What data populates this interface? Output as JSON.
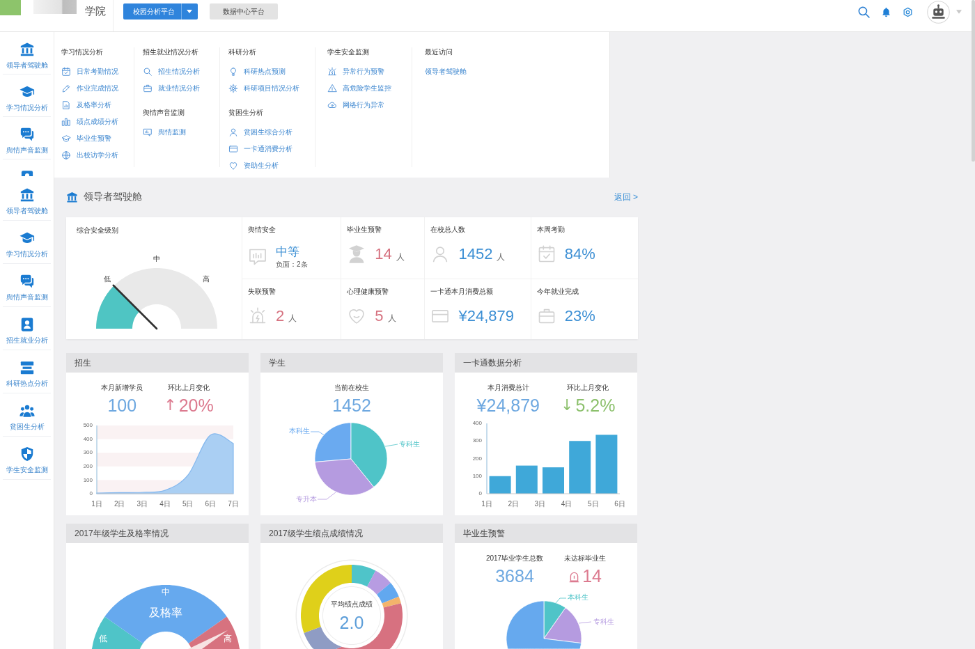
{
  "top_bar": {
    "school_name": "学院",
    "platform_buttons": [
      {
        "label": "校园分析平台",
        "selected": true,
        "dropdown": true
      },
      {
        "label": "数据中心平台",
        "selected": false,
        "dropdown": false
      }
    ]
  },
  "menu_overlay": {
    "sidebar_items": [
      "领导者驾驶舱",
      "学习情况分析",
      "舆情声音监测"
    ],
    "columns": [
      {
        "sections": [
          {
            "title": "学习情况分析",
            "items": [
              "日常考勤情况",
              "作业完成情况",
              "及格率分析",
              "绩点成绩分析",
              "毕业生预警",
              "出校访学分析"
            ]
          }
        ]
      },
      {
        "sections": [
          {
            "title": "招生就业情况分析",
            "items": [
              "招生情况分析",
              "就业情况分析"
            ]
          },
          {
            "title": "舆情声音监测",
            "items": [
              "舆情监测"
            ]
          }
        ]
      },
      {
        "sections": [
          {
            "title": "科研分析",
            "items": [
              "科研热点预测",
              "科研项目情况分析"
            ]
          },
          {
            "title": "贫困生分析",
            "items": [
              "贫困生综合分析",
              "一卡通消费分析",
              "资助生分析"
            ]
          }
        ]
      },
      {
        "sections": [
          {
            "title": "学生安全监测",
            "items": [
              "异常行为预警",
              "高危险学生监控",
              "网络行为异常"
            ]
          }
        ]
      },
      {
        "sections": [
          {
            "title": "最近访问",
            "items": [
              "领导者驾驶舱"
            ]
          }
        ]
      }
    ]
  },
  "sidebar": {
    "items": [
      "领导者驾驶舱",
      "学习情况分析",
      "舆情声音监测",
      "招生就业分析",
      "科研热点分析",
      "贫困生分析",
      "学生安全监测"
    ]
  },
  "page_header": {
    "title": "领导者驾驶舱",
    "back_link": "返回 >"
  },
  "kpi_panel": {
    "gauge": {
      "title": "综合安全级别",
      "labels": [
        "低",
        "中",
        "高"
      ],
      "level": 0.25
    },
    "metrics": [
      {
        "label": "舆情安全",
        "value": "中等",
        "note": "负面：2条",
        "color": "#3c8fd4"
      },
      {
        "label": "毕业生预警",
        "value": "14",
        "unit": "人",
        "color": "#d6717f"
      },
      {
        "label": "在校总人数",
        "value": "1452",
        "unit": "人",
        "color": "#3c8fd4"
      },
      {
        "label": "本周考勤",
        "value": "84%",
        "color": "#3c8fd4"
      },
      {
        "label": "失联预警",
        "value": "2",
        "unit": "人",
        "color": "#d6717f"
      },
      {
        "label": "心理健康预警",
        "value": "5",
        "unit": "人",
        "color": "#d6717f"
      },
      {
        "label": "一卡通本月消费总额",
        "value": "¥24,879",
        "color": "#3c8fd4"
      },
      {
        "label": "今年就业完成",
        "value": "23%",
        "color": "#3c8fd4"
      }
    ]
  },
  "panels": [
    {
      "kind": "chart",
      "title": "招生",
      "stats": [
        {
          "label": "本月新增学员",
          "value": "100",
          "color": "#6ea8e0"
        },
        {
          "label": "环比上月变化",
          "arrow": "↑",
          "value": "20%",
          "color": "#dc7a8f"
        }
      ],
      "chart_data": {
        "type": "area",
        "categories": [
          "1日",
          "2日",
          "3日",
          "4日",
          "5日",
          "6日",
          "7日"
        ],
        "values": [
          5,
          8,
          10,
          25,
          135,
          430,
          368
        ],
        "ylim": [
          0,
          500
        ],
        "yticks": [
          0,
          100,
          200,
          300,
          400,
          500
        ]
      }
    },
    {
      "kind": "pie",
      "title": "学生",
      "stats": [
        {
          "label": "当前在校生",
          "value": "1452",
          "color": "#6ea8e0"
        }
      ],
      "segments": [
        {
          "label": "本科生",
          "color": "#6aaaf0"
        },
        {
          "label": "专科生",
          "color": "#4fc4c8"
        },
        {
          "label": "专升本",
          "color": "#b59be0"
        }
      ]
    },
    {
      "kind": "chart",
      "title": "一卡通数据分析",
      "stats": [
        {
          "label": "本月消费总计",
          "value": "¥24,879",
          "color": "#6ea8e0"
        },
        {
          "label": "环比上月变化",
          "arrow": "↓",
          "value": "5.2%",
          "color": "#8cc06c"
        }
      ],
      "chart_data": {
        "type": "bar",
        "x": [
          1.5,
          2.5,
          3.5,
          4.5,
          5.5
        ],
        "values": [
          100,
          160,
          150,
          300,
          335
        ],
        "xlim": [
          1,
          6
        ],
        "xticks": [
          {
            "value": 1,
            "label": "1日"
          },
          {
            "value": 2,
            "label": "2日"
          },
          {
            "value": 3,
            "label": "3日"
          },
          {
            "value": 4,
            "label": "4日"
          },
          {
            "value": 5,
            "label": "5日"
          },
          {
            "value": 6,
            "label": "6日"
          }
        ],
        "ylim": [
          0,
          400
        ],
        "yticks": [
          0,
          100,
          200,
          300,
          400
        ]
      }
    },
    {
      "kind": "gauge",
      "title": "2017年级学生及格率情况",
      "center_label": "及格率",
      "segments": [
        {
          "label": "低",
          "color": "#4fc4c8"
        },
        {
          "label": "中",
          "color": "#66a9ee"
        },
        {
          "label": "高",
          "color": "#d7727f"
        }
      ]
    },
    {
      "kind": "donut",
      "title": "2017级学生绩点成绩情况",
      "center_label": "平均绩点成绩",
      "center_value": "2.0"
    },
    {
      "kind": "pie",
      "title": "毕业生预警",
      "stats": [
        {
          "label": "2017毕业学生总数",
          "value": "3684",
          "color": "#6ea8e0",
          "alert": false
        },
        {
          "label": "未达标毕业生",
          "value": "14",
          "color": "#dc7a8f",
          "alert": true
        }
      ],
      "segments": [
        {
          "label": "本科生",
          "color": "#4fc4c8"
        },
        {
          "label": "专科生",
          "color": "#b59be0"
        },
        {
          "color": "#66a9ee"
        }
      ]
    }
  ]
}
